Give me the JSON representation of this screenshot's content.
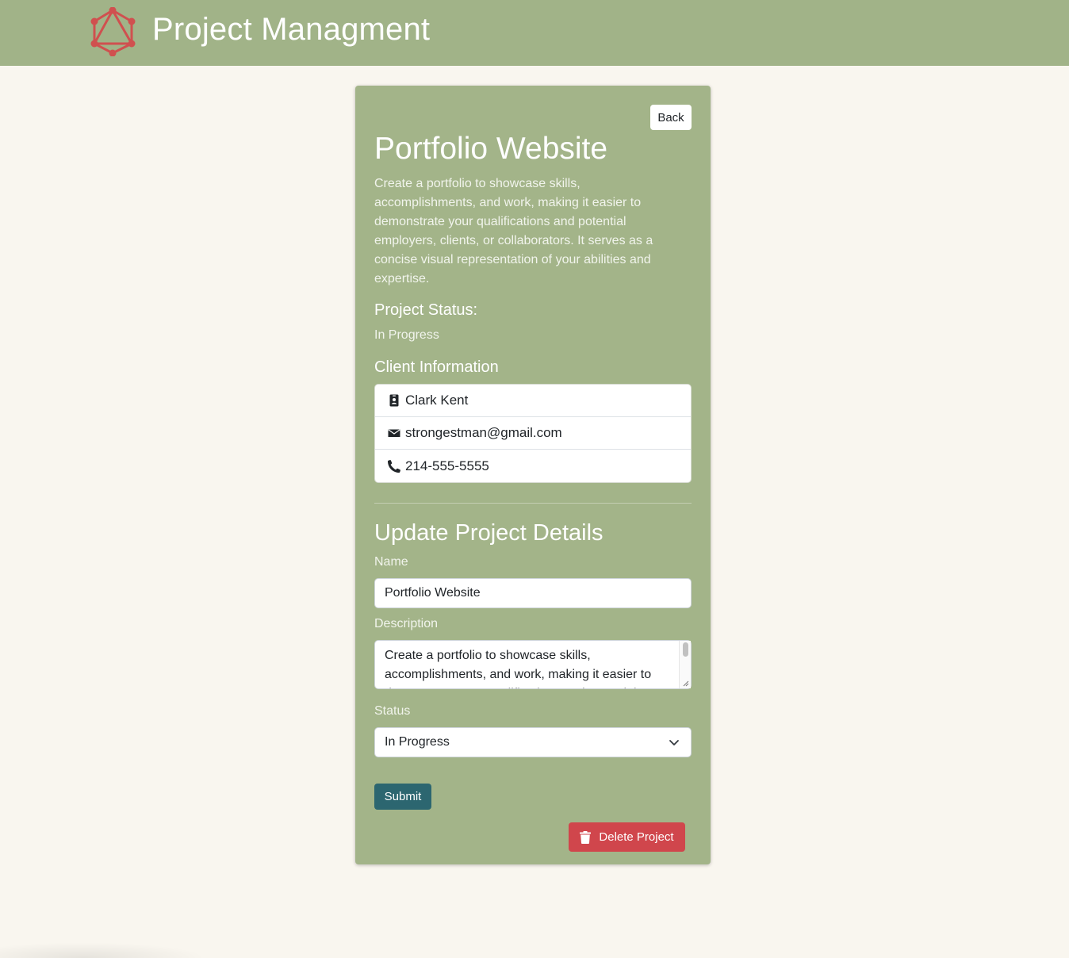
{
  "header": {
    "title": "Project Managment",
    "logo_icon": "graphql-logo-icon",
    "logo_color": "#d0504f"
  },
  "project": {
    "back_label": "Back",
    "name": "Portfolio Website",
    "description": "Create a portfolio to showcase skills, accomplishments, and work, making it easier to demonstrate your qualifications and potential employers, clients, or collaborators. It serves as a concise visual representation of your abilities and expertise.",
    "status_heading": "Project Status:",
    "status": "In Progress"
  },
  "client": {
    "heading": "Client Information",
    "name": "Clark Kent",
    "email": "strongestman@gmail.com",
    "phone": "214-555-5555",
    "icons": [
      "id-badge-icon",
      "envelope-icon",
      "phone-icon"
    ]
  },
  "form": {
    "heading": "Update Project Details",
    "name_label": "Name",
    "name_value": "Portfolio Website",
    "description_label": "Description",
    "description_value": "Create a portfolio to showcase skills, accomplishments, and work, making it easier to demonstrate your qualifications and potential employers, clients, or collaborators. It serves as a concise visual representation of your abilities and expertise.",
    "status_label": "Status",
    "status_selected": "In Progress",
    "submit_label": "Submit",
    "delete_label": "Delete Project"
  },
  "colors": {
    "navbar": "#a1b388",
    "card": "#a3b489",
    "page_background": "#f9f6ef",
    "submit": "#2c6670",
    "delete": "#d0464c"
  }
}
